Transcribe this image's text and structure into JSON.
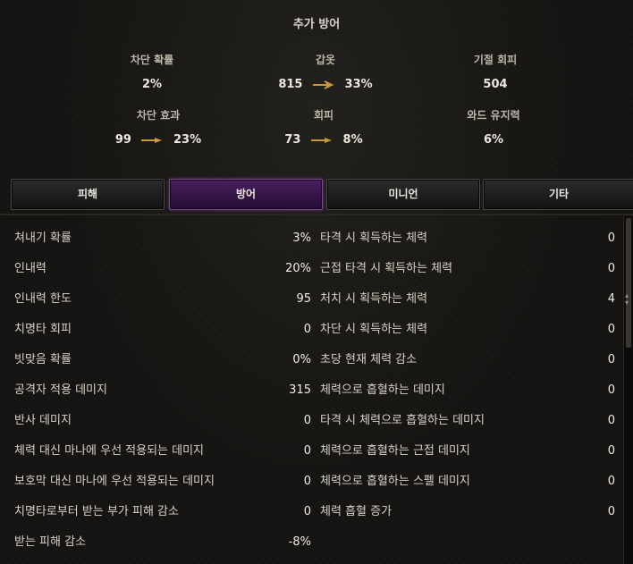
{
  "section_title": "추가 방어",
  "top_stats": [
    {
      "label": "차단 확률",
      "value": "2%"
    },
    {
      "label": "갑옷",
      "value": "815",
      "value2": "33%"
    },
    {
      "label": "기절 회피",
      "value": "504"
    },
    {
      "label": "차단 효과",
      "value": "99",
      "value2": "23%"
    },
    {
      "label": "회피",
      "value": "73",
      "value2": "8%"
    },
    {
      "label": "와드 유지력",
      "value": "6%"
    }
  ],
  "tabs": [
    {
      "label": "피해",
      "active": false
    },
    {
      "label": "방어",
      "active": true
    },
    {
      "label": "미니언",
      "active": false
    },
    {
      "label": "기타",
      "active": false
    }
  ],
  "left_stats": [
    {
      "name": "쳐내기 확률",
      "value": "3%"
    },
    {
      "name": "인내력",
      "value": "20%"
    },
    {
      "name": "인내력 한도",
      "value": "95"
    },
    {
      "name": "치명타 회피",
      "value": "0"
    },
    {
      "name": "빗맞음 확률",
      "value": "0%"
    },
    {
      "name": "공격자 적용 데미지",
      "value": "315"
    },
    {
      "name": "반사 데미지",
      "value": "0"
    },
    {
      "name": "체력 대신 마나에 우선 적용되는 데미지",
      "value": "0"
    },
    {
      "name": "보호막 대신 마나에 우선 적용되는 데미지",
      "value": "0"
    },
    {
      "name": "치명타로부터 받는 부가 피해 감소",
      "value": "0"
    },
    {
      "name": "받는 피해 감소",
      "value": "-8%"
    }
  ],
  "right_stats": [
    {
      "name": "타격 시 획득하는 체력",
      "value": "0"
    },
    {
      "name": "근접 타격 시 획득하는 체력",
      "value": "0"
    },
    {
      "name": "처치 시 획득하는 체력",
      "value": "4"
    },
    {
      "name": "차단 시 획득하는 체력",
      "value": "0"
    },
    {
      "name": "초당 현재 체력 감소",
      "value": "0"
    },
    {
      "name": "체력으로 흡혈하는 데미지",
      "value": "0"
    },
    {
      "name": "타격 시 체력으로 흡혈하는 데미지",
      "value": "0"
    },
    {
      "name": "체력으로 흡혈하는 근접 데미지",
      "value": "0"
    },
    {
      "name": "체력으로 흡혈하는 스펠 데미지",
      "value": "0"
    },
    {
      "name": "체력 흡혈 증가",
      "value": "0"
    }
  ],
  "colors": {
    "accent_active_tab": "#4a2160",
    "arrow": "#c99a3a"
  }
}
